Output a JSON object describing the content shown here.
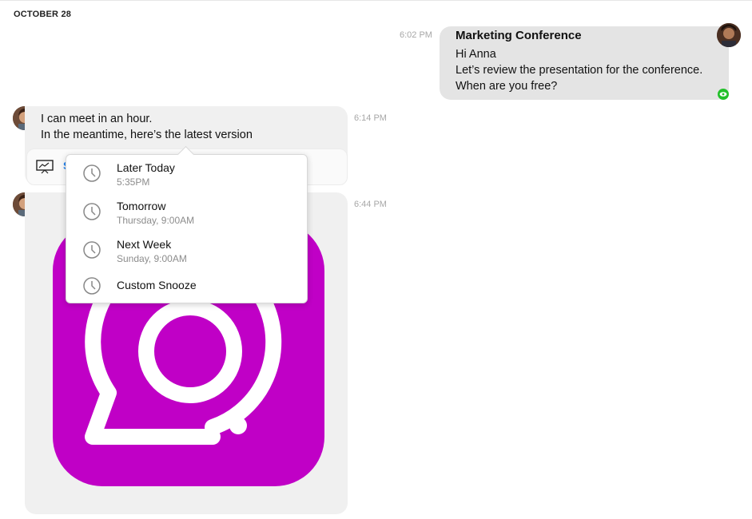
{
  "date_header": "OCTOBER 28",
  "colors": {
    "outgoing_bubble": "#e4e4e4",
    "incoming_bubble": "#f0f0f0",
    "brand_magenta": "#c000c6",
    "seen_green": "#22c02a",
    "link_blue": "#1a7ff0"
  },
  "messages": {
    "outgoing": {
      "time": "6:02 PM",
      "title": "Marketing Conference",
      "lines": [
        "Hi Anna",
        "Let’s review the presentation for the conference.",
        "When are you free?"
      ],
      "status_icon": "eye-icon"
    },
    "incoming_text": {
      "time": "6:14 PM",
      "lines": [
        "I can meet in an hour.",
        "In the meantime, here’s the latest version"
      ],
      "attachment": {
        "icon": "presentation-icon",
        "label_peek": "S"
      }
    },
    "incoming_image": {
      "time": "6:44 PM",
      "image": "app-logo-speech-bubble-at-sign"
    }
  },
  "snooze_menu": {
    "items": [
      {
        "label": "Later Today",
        "sub": "5:35PM",
        "icon": "clock-icon"
      },
      {
        "label": "Tomorrow",
        "sub": "Thursday, 9:00AM",
        "icon": "clock-icon"
      },
      {
        "label": "Next Week",
        "sub": "Sunday, 9:00AM",
        "icon": "clock-icon"
      },
      {
        "label": "Custom Snooze",
        "sub": "",
        "icon": "clock-icon"
      }
    ]
  }
}
